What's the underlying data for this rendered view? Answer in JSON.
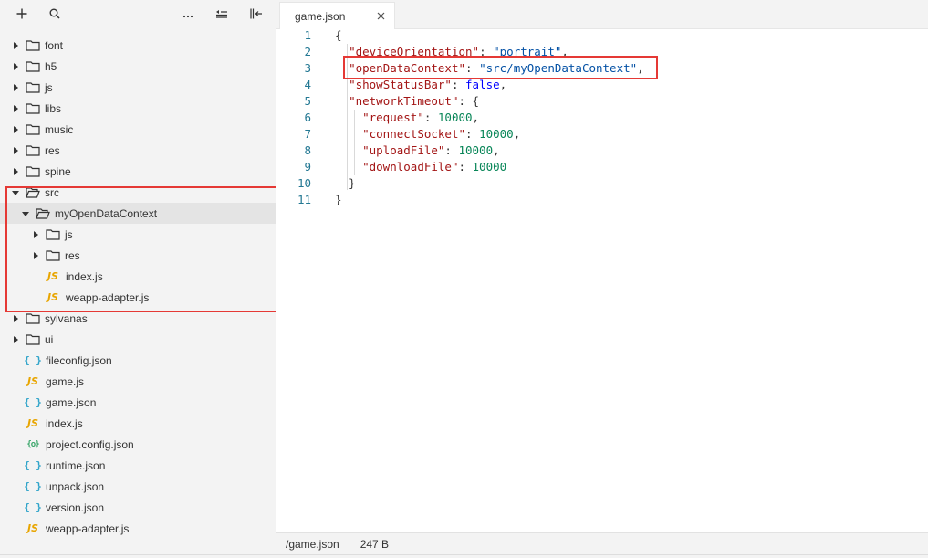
{
  "toolbar": {
    "buttons": [
      {
        "icon": "plus-icon"
      },
      {
        "icon": "search-icon"
      },
      {
        "icon": "more-icon"
      },
      {
        "icon": "collapse-all-icon"
      },
      {
        "icon": "panel-toggle-icon"
      }
    ]
  },
  "tree": [
    {
      "label": "font",
      "type": "folder",
      "depth": 0,
      "expanded": false
    },
    {
      "label": "h5",
      "type": "folder",
      "depth": 0,
      "expanded": false
    },
    {
      "label": "js",
      "type": "folder",
      "depth": 0,
      "expanded": false
    },
    {
      "label": "libs",
      "type": "folder",
      "depth": 0,
      "expanded": false
    },
    {
      "label": "music",
      "type": "folder",
      "depth": 0,
      "expanded": false
    },
    {
      "label": "res",
      "type": "folder",
      "depth": 0,
      "expanded": false
    },
    {
      "label": "spine",
      "type": "folder",
      "depth": 0,
      "expanded": false
    },
    {
      "label": "src",
      "type": "folder",
      "depth": 0,
      "expanded": true
    },
    {
      "label": "myOpenDataContext",
      "type": "folder",
      "depth": 1,
      "expanded": true,
      "selected": true
    },
    {
      "label": "js",
      "type": "folder",
      "depth": 2,
      "expanded": false
    },
    {
      "label": "res",
      "type": "folder",
      "depth": 2,
      "expanded": false
    },
    {
      "label": "index.js",
      "type": "js",
      "depth": 2
    },
    {
      "label": "weapp-adapter.js",
      "type": "js",
      "depth": 2
    },
    {
      "label": "sylvanas",
      "type": "folder",
      "depth": 0,
      "expanded": false
    },
    {
      "label": "ui",
      "type": "folder",
      "depth": 0,
      "expanded": false
    },
    {
      "label": "fileconfig.json",
      "type": "json",
      "depth": 0
    },
    {
      "label": "game.js",
      "type": "js",
      "depth": 0
    },
    {
      "label": "game.json",
      "type": "json",
      "depth": 0
    },
    {
      "label": "index.js",
      "type": "js",
      "depth": 0
    },
    {
      "label": "project.config.json",
      "type": "config",
      "depth": 0
    },
    {
      "label": "runtime.json",
      "type": "json",
      "depth": 0
    },
    {
      "label": "unpack.json",
      "type": "json",
      "depth": 0
    },
    {
      "label": "version.json",
      "type": "json",
      "depth": 0
    },
    {
      "label": "weapp-adapter.js",
      "type": "js",
      "depth": 0
    }
  ],
  "icons": {
    "js": "JS",
    "json": "{ }",
    "config": "{o}"
  },
  "editor": {
    "tab_title": "game.json",
    "lines": [
      [
        [
          "p",
          "{"
        ]
      ],
      [
        [
          "p",
          "  "
        ],
        [
          "k",
          "\"deviceOrientation\""
        ],
        [
          "p",
          ": "
        ],
        [
          "s",
          "\"portrait\""
        ],
        [
          "p",
          ","
        ]
      ],
      [
        [
          "p",
          "  "
        ],
        [
          "k",
          "\"openDataContext\""
        ],
        [
          "p",
          ": "
        ],
        [
          "s",
          "\"src/myOpenDataContext\""
        ],
        [
          "p",
          ","
        ]
      ],
      [
        [
          "p",
          "  "
        ],
        [
          "k",
          "\"showStatusBar\""
        ],
        [
          "p",
          ": "
        ],
        [
          "b",
          "false"
        ],
        [
          "p",
          ","
        ]
      ],
      [
        [
          "p",
          "  "
        ],
        [
          "k",
          "\"networkTimeout\""
        ],
        [
          "p",
          ": {"
        ]
      ],
      [
        [
          "p",
          "    "
        ],
        [
          "k",
          "\"request\""
        ],
        [
          "p",
          ": "
        ],
        [
          "n",
          "10000"
        ],
        [
          "p",
          ","
        ]
      ],
      [
        [
          "p",
          "    "
        ],
        [
          "k",
          "\"connectSocket\""
        ],
        [
          "p",
          ": "
        ],
        [
          "n",
          "10000"
        ],
        [
          "p",
          ","
        ]
      ],
      [
        [
          "p",
          "    "
        ],
        [
          "k",
          "\"uploadFile\""
        ],
        [
          "p",
          ": "
        ],
        [
          "n",
          "10000"
        ],
        [
          "p",
          ","
        ]
      ],
      [
        [
          "p",
          "    "
        ],
        [
          "k",
          "\"downloadFile\""
        ],
        [
          "p",
          ": "
        ],
        [
          "n",
          "10000"
        ]
      ],
      [
        [
          "p",
          "  }"
        ]
      ],
      [
        [
          "p",
          "}"
        ]
      ]
    ]
  },
  "status": {
    "path": "/game.json",
    "size": "247 B"
  },
  "colors": {
    "highlight": "#e53935",
    "js": "#e8a500",
    "json": "#2ea3c9",
    "config": "#3aa66a"
  }
}
